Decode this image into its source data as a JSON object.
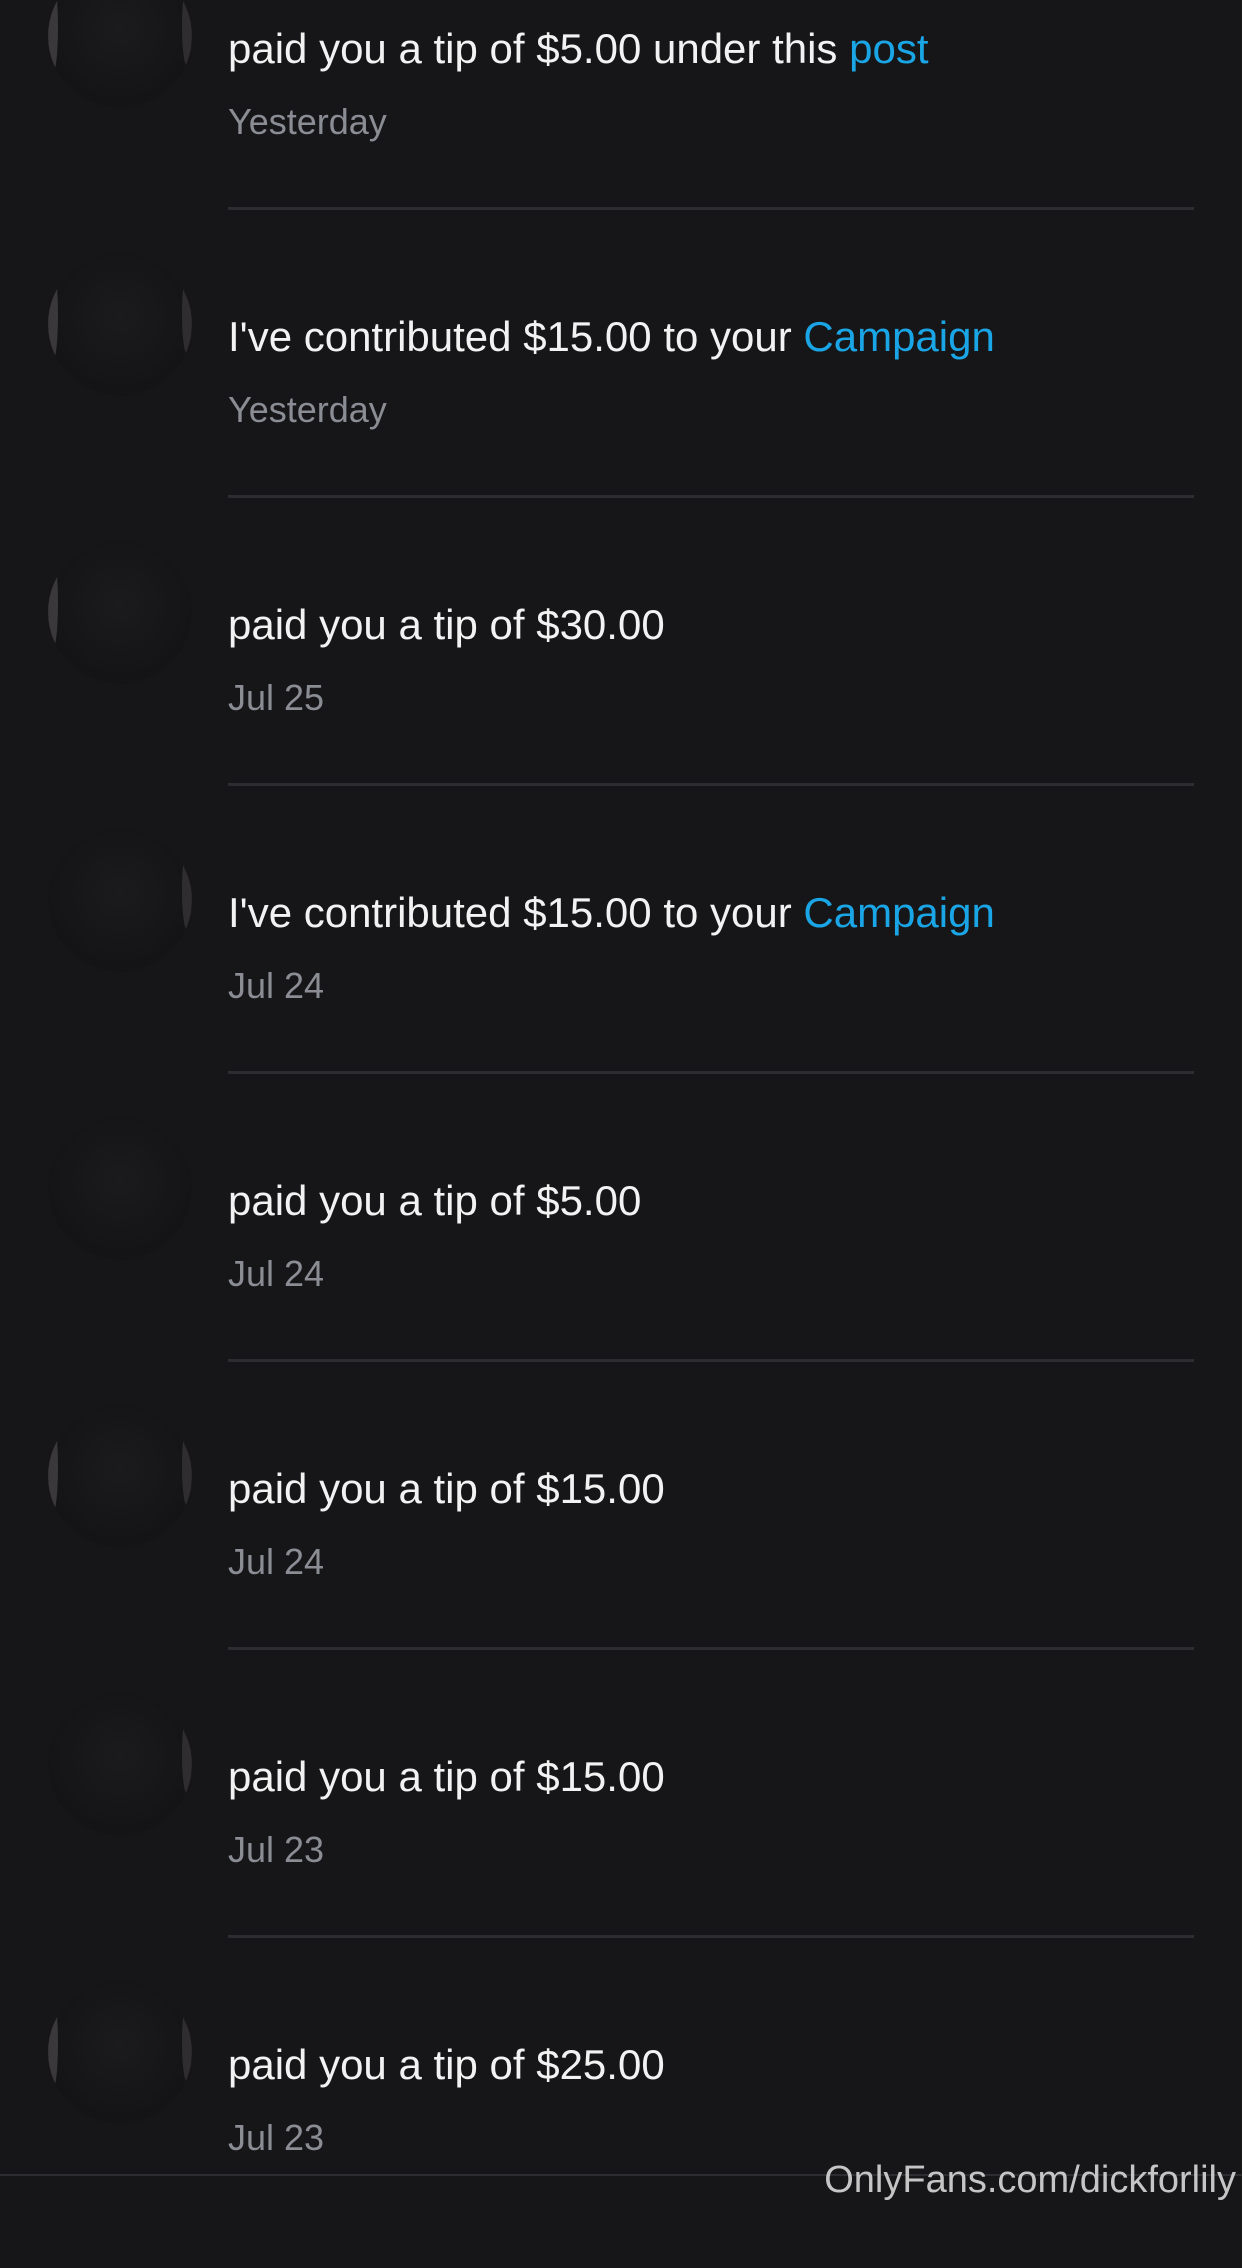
{
  "notifications": [
    {
      "text": "paid you a tip of $5.00 under this ",
      "link": "post",
      "time": "Yesterday"
    },
    {
      "text": "I've contributed $15.00 to your ",
      "link": "Campaign",
      "time": "Yesterday"
    },
    {
      "text": "paid you a tip of $30.00",
      "link": "",
      "time": "Jul 25"
    },
    {
      "text": "I've contributed $15.00 to your ",
      "link": "Campaign",
      "time": "Jul 24"
    },
    {
      "text": "paid you a tip of $5.00",
      "link": "",
      "time": "Jul 24"
    },
    {
      "text": "paid you a tip of $15.00",
      "link": "",
      "time": "Jul 24"
    },
    {
      "text": "paid you a tip of $15.00",
      "link": "",
      "time": "Jul 23"
    },
    {
      "text": "paid you a tip of $25.00",
      "link": "",
      "time": "Jul 23"
    }
  ],
  "watermark": "OnlyFans.com/dickforlily",
  "colors": {
    "background": "#161618",
    "link": "#1aa6e6",
    "timestamp": "#8a8d94",
    "divider": "#2c2d31"
  }
}
